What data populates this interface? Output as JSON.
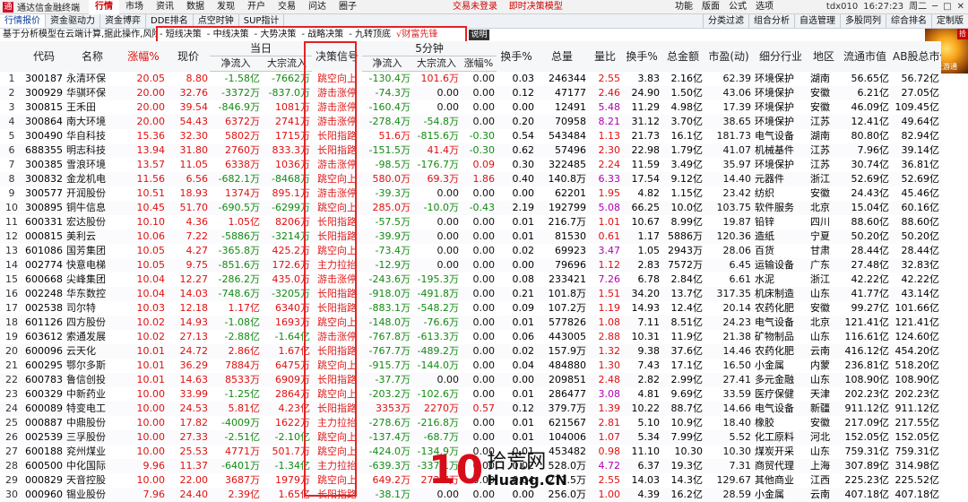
{
  "app": {
    "title": "通达信金融终端",
    "logo": "通"
  },
  "menu": [
    "行情",
    "市场",
    "资讯",
    "数据",
    "发现",
    "开户",
    "交易",
    "问达",
    "圈子"
  ],
  "notice": {
    "unlogged": "交易未登录",
    "realtime": "即时决策模型"
  },
  "right_menu": [
    "功能",
    "版面",
    "公式",
    "选项"
  ],
  "window": {
    "user": "tdx010",
    "time": "16:27:23",
    "day": "周二"
  },
  "tabs": [
    "行情报价",
    "资金驱动力",
    "资金博弈",
    "DDE排名",
    "点空时钟",
    "SUP指计"
  ],
  "right_tools": [
    "分类过滤",
    "组合分析",
    "自选管理",
    "多股同列",
    "综合排名",
    "定制版"
  ],
  "info_msg": "基于分析模型在云端计算,据此操作,风险自担",
  "modes": [
    "- 短线决策",
    "- 中线决策",
    "- 大势决策",
    "- 战略决策",
    "- 九转顶底",
    "√财富先锋"
  ],
  "desc_btn": "说明",
  "thumb": {
    "tag": "拾",
    "caption": "上游通"
  },
  "headers": {
    "group_today": "当日",
    "group_5min": "5分钟",
    "columns": [
      "代码",
      "名称",
      "涨幅%",
      "现价",
      "净流入",
      "大宗流入",
      "决策信号",
      "净流入",
      "大宗流入",
      "涨幅%",
      "换手%",
      "总量",
      "量比",
      "换手%",
      "总金额",
      "市盈(动)",
      "细分行业",
      "地区",
      "流通市值",
      "AB股总市值"
    ]
  },
  "rows": [
    [
      "1",
      "300187",
      "永清环保",
      "20.05",
      "8.80",
      "-1.58亿",
      "-7662万",
      "跳空向上",
      "-130.4万",
      "101.6万",
      "0.00",
      "0.03",
      "246344",
      "2.55",
      "3.83",
      "2.16亿",
      "62.39",
      "环境保护",
      "湖南",
      "56.65亿",
      "56.72亿"
    ],
    [
      "2",
      "300929",
      "华骐环保",
      "20.00",
      "32.76",
      "-3372万",
      "-837.0万",
      "游击涨停",
      "-74.3万",
      "0.00",
      "0.00",
      "0.12",
      "47177",
      "2.46",
      "24.90",
      "1.50亿",
      "43.06",
      "环境保护",
      "安徽",
      "6.21亿",
      "27.05亿"
    ],
    [
      "3",
      "300815",
      "王禾田",
      "20.00",
      "39.54",
      "-846.9万",
      "1081万",
      "游击涨停",
      "-160.4万",
      "0.00",
      "0.00",
      "0.00",
      "12491",
      "5.48",
      "11.29",
      "4.98亿",
      "17.39",
      "环境保护",
      "安徽",
      "46.09亿",
      "109.45亿"
    ],
    [
      "4",
      "300864",
      "南大环境",
      "20.00",
      "54.43",
      "6372万",
      "2741万",
      "游击涨停",
      "-278.4万",
      "-54.8万",
      "0.00",
      "0.20",
      "70958",
      "8.21",
      "31.12",
      "3.70亿",
      "38.65",
      "环境保护",
      "江苏",
      "12.41亿",
      "49.64亿"
    ],
    [
      "5",
      "300490",
      "华自科技",
      "15.36",
      "32.30",
      "5802万",
      "1715万",
      "长阳指路",
      "51.6万",
      "-815.6万",
      "-0.30",
      "0.54",
      "543484",
      "1.13",
      "21.73",
      "16.1亿",
      "181.73",
      "电气设备",
      "湖南",
      "80.80亿",
      "82.94亿"
    ],
    [
      "6",
      "688355",
      "明志科技",
      "13.94",
      "31.80",
      "2760万",
      "833.3万",
      "长阳指路",
      "-151.5万",
      "41.4万",
      "-0.30",
      "0.62",
      "57496",
      "2.30",
      "22.98",
      "1.79亿",
      "41.07",
      "机械基件",
      "江苏",
      "7.96亿",
      "39.14亿"
    ],
    [
      "7",
      "300385",
      "雪浪环境",
      "13.57",
      "11.05",
      "6338万",
      "1036万",
      "游击涨停",
      "-98.5万",
      "-176.7万",
      "0.09",
      "0.30",
      "322485",
      "2.24",
      "11.59",
      "3.49亿",
      "35.97",
      "环境保护",
      "江苏",
      "30.74亿",
      "36.81亿"
    ],
    [
      "8",
      "300832",
      "金龙机电",
      "11.56",
      "6.56",
      "-682.1万",
      "-8468万",
      "跳空向上",
      "580.0万",
      "69.3万",
      "1.86",
      "0.40",
      "140.8万",
      "6.33",
      "17.54",
      "9.12亿",
      "14.40",
      "元器件",
      "浙江",
      "52.69亿",
      "52.69亿"
    ],
    [
      "9",
      "300577",
      "开润股份",
      "10.51",
      "18.93",
      "1374万",
      "895.1万",
      "游击涨停",
      "-39.3万",
      "0.00",
      "0.00",
      "0.00",
      "62201",
      "1.95",
      "4.82",
      "1.15亿",
      "23.42",
      "纺织",
      "安徽",
      "24.43亿",
      "45.46亿"
    ],
    [
      "10",
      "300895",
      "铜牛信息",
      "10.45",
      "51.70",
      "-690.5万",
      "-6299万",
      "跳空向上",
      "285.0万",
      "-10.0万",
      "-0.43",
      "2.19",
      "192799",
      "5.08",
      "66.25",
      "10.0亿",
      "103.75",
      "软件服务",
      "北京",
      "15.04亿",
      "60.16亿"
    ],
    [
      "11",
      "600331",
      "宏达股份",
      "10.10",
      "4.36",
      "1.05亿",
      "8206万",
      "长阳指路",
      "-57.5万",
      "0.00",
      "0.00",
      "0.01",
      "216.7万",
      "1.01",
      "10.67",
      "8.99亿",
      "19.87",
      "铅锌",
      "四川",
      "88.60亿",
      "88.60亿"
    ],
    [
      "12",
      "000815",
      "美利云",
      "10.06",
      "7.22",
      "-5886万",
      "-3214万",
      "长阳指路",
      "-39.9万",
      "0.00",
      "0.00",
      "0.01",
      "81530",
      "0.61",
      "1.17",
      "5886万",
      "120.36",
      "造纸",
      "宁夏",
      "50.20亿",
      "50.20亿"
    ],
    [
      "13",
      "601086",
      "国芳集团",
      "10.05",
      "4.27",
      "-365.8万",
      "425.2万",
      "跳空向上",
      "-73.4万",
      "0.00",
      "0.00",
      "0.02",
      "69923",
      "3.47",
      "1.05",
      "2943万",
      "28.06",
      "百货",
      "甘肃",
      "28.44亿",
      "28.44亿"
    ],
    [
      "14",
      "002774",
      "快意电梯",
      "10.05",
      "9.75",
      "-851.6万",
      "172.6万",
      "主力拉抬",
      "-12.9万",
      "0.00",
      "0.00",
      "0.00",
      "79696",
      "1.12",
      "2.83",
      "7572万",
      "6.45",
      "运输设备",
      "广东",
      "27.48亿",
      "32.83亿"
    ],
    [
      "15",
      "600668",
      "尖峰集团",
      "10.04",
      "12.27",
      "-286.2万",
      "435.0万",
      "游击涨停",
      "-243.6万",
      "-195.3万",
      "0.00",
      "0.08",
      "233421",
      "7.26",
      "6.78",
      "2.84亿",
      "6.61",
      "水泥",
      "浙江",
      "42.22亿",
      "42.22亿"
    ],
    [
      "16",
      "002248",
      "华东数控",
      "10.04",
      "14.03",
      "-748.6万",
      "-3205万",
      "长阳指路",
      "-918.0万",
      "-491.8万",
      "0.00",
      "0.21",
      "101.8万",
      "1.51",
      "34.20",
      "13.7亿",
      "317.35",
      "机床制造",
      "山东",
      "41.77亿",
      "43.14亿"
    ],
    [
      "17",
      "002538",
      "司尔特",
      "10.03",
      "12.18",
      "1.17亿",
      "6340万",
      "长阳指路",
      "-883.1万",
      "-548.2万",
      "0.00",
      "0.09",
      "107.2万",
      "1.19",
      "14.93",
      "12.4亿",
      "20.14",
      "农药化肥",
      "安徽",
      "99.27亿",
      "101.66亿"
    ],
    [
      "18",
      "601126",
      "四方股份",
      "10.02",
      "14.93",
      "-1.08亿",
      "1693万",
      "跳空向上",
      "-148.0万",
      "-76.6万",
      "0.00",
      "0.01",
      "577826",
      "1.08",
      "7.11",
      "8.51亿",
      "24.23",
      "电气设备",
      "北京",
      "121.41亿",
      "121.41亿"
    ],
    [
      "19",
      "603612",
      "索通发展",
      "10.02",
      "27.13",
      "-2.88亿",
      "-1.64亿",
      "游击涨停",
      "-767.8万",
      "-613.3万",
      "0.00",
      "0.06",
      "443005",
      "2.88",
      "10.31",
      "11.9亿",
      "21.38",
      "矿物制品",
      "山东",
      "116.61亿",
      "124.60亿"
    ],
    [
      "20",
      "600096",
      "云天化",
      "10.01",
      "24.72",
      "2.86亿",
      "1.67亿",
      "长阳指路",
      "-767.7万",
      "-489.2万",
      "0.00",
      "0.02",
      "157.9万",
      "1.32",
      "9.38",
      "37.6亿",
      "14.46",
      "农药化肥",
      "云南",
      "416.12亿",
      "454.20亿"
    ],
    [
      "21",
      "600295",
      "鄂尔多斯",
      "10.01",
      "36.29",
      "7884万",
      "6475万",
      "跳空向上",
      "-915.7万",
      "-144.0万",
      "0.00",
      "0.04",
      "484880",
      "1.30",
      "7.43",
      "17.1亿",
      "16.50",
      "小金属",
      "内蒙",
      "236.81亿",
      "518.20亿"
    ],
    [
      "22",
      "600783",
      "鲁信创投",
      "10.01",
      "14.63",
      "8533万",
      "6909万",
      "长阳指路",
      "-37.7万",
      "0.00",
      "0.00",
      "0.00",
      "209851",
      "2.48",
      "2.82",
      "2.99亿",
      "27.41",
      "多元金融",
      "山东",
      "108.90亿",
      "108.90亿"
    ],
    [
      "23",
      "600329",
      "中新药业",
      "10.00",
      "33.99",
      "-1.25亿",
      "2864万",
      "跳空向上",
      "-203.2万",
      "-102.6万",
      "0.00",
      "0.01",
      "286477",
      "3.08",
      "4.81",
      "9.69亿",
      "33.59",
      "医疗保健",
      "天津",
      "202.23亿",
      "202.23亿"
    ],
    [
      "24",
      "600089",
      "特变电工",
      "10.00",
      "24.53",
      "5.81亿",
      "4.23亿",
      "长阳指路",
      "3353万",
      "2270万",
      "0.57",
      "0.12",
      "379.7万",
      "1.39",
      "10.22",
      "88.7亿",
      "14.66",
      "电气设备",
      "新疆",
      "911.12亿",
      "911.12亿"
    ],
    [
      "25",
      "000887",
      "中鼎股份",
      "10.00",
      "17.82",
      "-4009万",
      "1622万",
      "主力拉抬",
      "-278.6万",
      "-216.8万",
      "0.00",
      "0.01",
      "621567",
      "2.81",
      "5.10",
      "10.9亿",
      "18.40",
      "橡胶",
      "安徽",
      "217.09亿",
      "217.55亿"
    ],
    [
      "26",
      "002539",
      "三孚股份",
      "10.00",
      "27.33",
      "-2.51亿",
      "-2.10亿",
      "跳空向上",
      "-137.4万",
      "-68.7万",
      "0.00",
      "0.01",
      "104006",
      "1.07",
      "5.34",
      "7.99亿",
      "5.52",
      "化工原料",
      "河北",
      "152.05亿",
      "152.05亿"
    ],
    [
      "27",
      "600188",
      "兖州煤业",
      "10.00",
      "25.53",
      "4771万",
      "501.7万",
      "跳空向上",
      "-424.0万",
      "-134.9万",
      "0.00",
      "0.01",
      "453482",
      "0.98",
      "11.10",
      "10.30",
      "10.30",
      "煤炭开采",
      "山东",
      "759.31亿",
      "759.31亿"
    ],
    [
      "28",
      "600500",
      "中化国际",
      "9.96",
      "11.37",
      "-6401万",
      "-1.34亿",
      "主力拉抬",
      "-639.3万",
      "-337.1万",
      "0.00",
      "0.02",
      "528.0万",
      "4.72",
      "6.37",
      "19.3亿",
      "7.31",
      "商贸代理",
      "上海",
      "307.89亿",
      "314.98亿"
    ],
    [
      "29",
      "000829",
      "天音控股",
      "10.00",
      "22.00",
      "3687万",
      "1979万",
      "跳空向上",
      "649.2万",
      "272.7万",
      "0.00",
      "0.04",
      "271.5万",
      "2.55",
      "14.03",
      "14.3亿",
      "129.67",
      "其他商业",
      "江西",
      "225.23亿",
      "225.52亿"
    ],
    [
      "30",
      "000960",
      "锡业股份",
      "7.96",
      "24.40",
      "2.39亿",
      "1.65亿",
      "长阳指路",
      "-38.1万",
      "0.00",
      "0.00",
      "0.00",
      "256.0万",
      "1.00",
      "4.39",
      "16.2亿",
      "28.59",
      "小金属",
      "云南",
      "407.18亿",
      "407.18亿"
    ]
  ],
  "watermark": {
    "big": "10",
    "site": "拾荒网",
    "domain": "Huang.CN"
  },
  "colors": {
    "up": "#e01010",
    "down": "#138a13",
    "signal": "#e02020",
    "highlight_box": "#e02424"
  }
}
